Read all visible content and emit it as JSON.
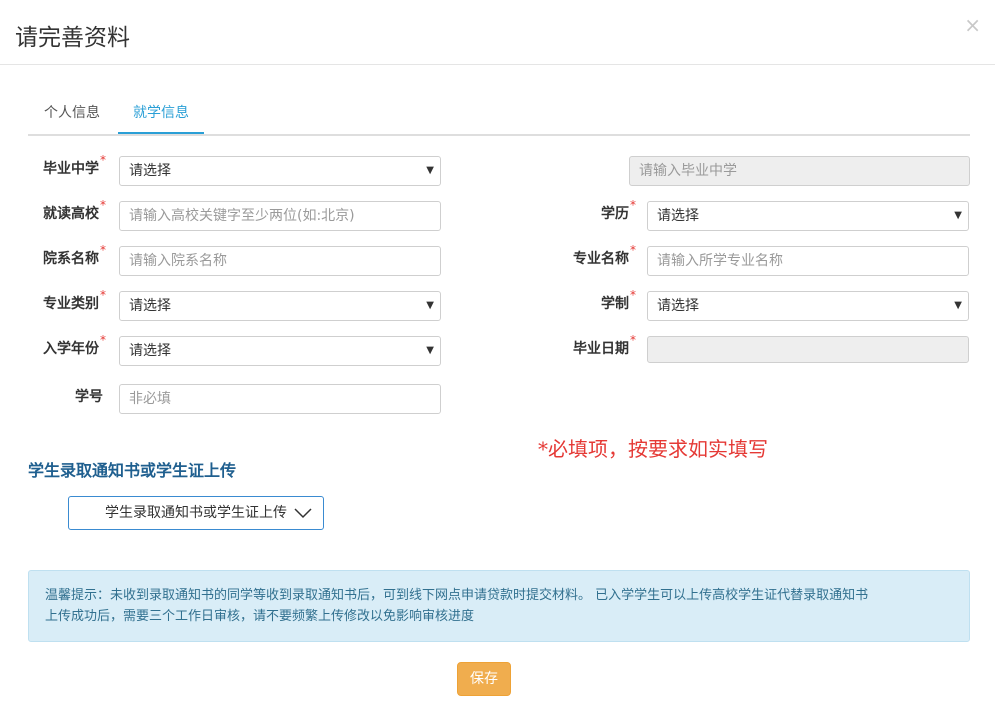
{
  "modal": {
    "title": "请完善资料",
    "close": "×"
  },
  "tabs": [
    {
      "label": "个人信息",
      "active": false
    },
    {
      "label": "就学信息",
      "active": true
    }
  ],
  "form": {
    "required_mark": "*",
    "graduate_school": {
      "label": "毕业中学",
      "value": "请选择",
      "input_placeholder": "请输入毕业中学"
    },
    "college": {
      "label": "就读高校",
      "placeholder": "请输入高校关键字至少两位(如:北京)"
    },
    "degree": {
      "label": "学历",
      "value": "请选择"
    },
    "department": {
      "label": "院系名称",
      "placeholder": "请输入院系名称"
    },
    "major": {
      "label": "专业名称",
      "placeholder": "请输入所学专业名称"
    },
    "major_type": {
      "label": "专业类别",
      "value": "请选择"
    },
    "duration": {
      "label": "学制",
      "value": "请选择"
    },
    "enroll_year": {
      "label": "入学年份",
      "value": "请选择"
    },
    "graduate_date": {
      "label": "毕业日期",
      "value": ""
    },
    "student_id": {
      "label": "学号",
      "placeholder": "非必填"
    }
  },
  "required_notice": "*必填项，按要求如实填写",
  "upload": {
    "section_title": "学生录取通知书或学生证上传",
    "button_label": "学生录取通知书或学生证上传"
  },
  "tip": {
    "line1": "温馨提示：未收到录取通知书的同学等收到录取通知书后，可到线下网点申请贷款时提交材料。 已入学学生可以上传高校学生证代替录取通知书",
    "line2": "上传成功后，需要三个工作日审核，请不要频繁上传修改以免影响审核进度"
  },
  "save_label": "保存",
  "colors": {
    "accent": "#2a9fd6",
    "required": "#e53935",
    "save": "#f0ad4e",
    "tip_bg": "#d9edf7"
  }
}
